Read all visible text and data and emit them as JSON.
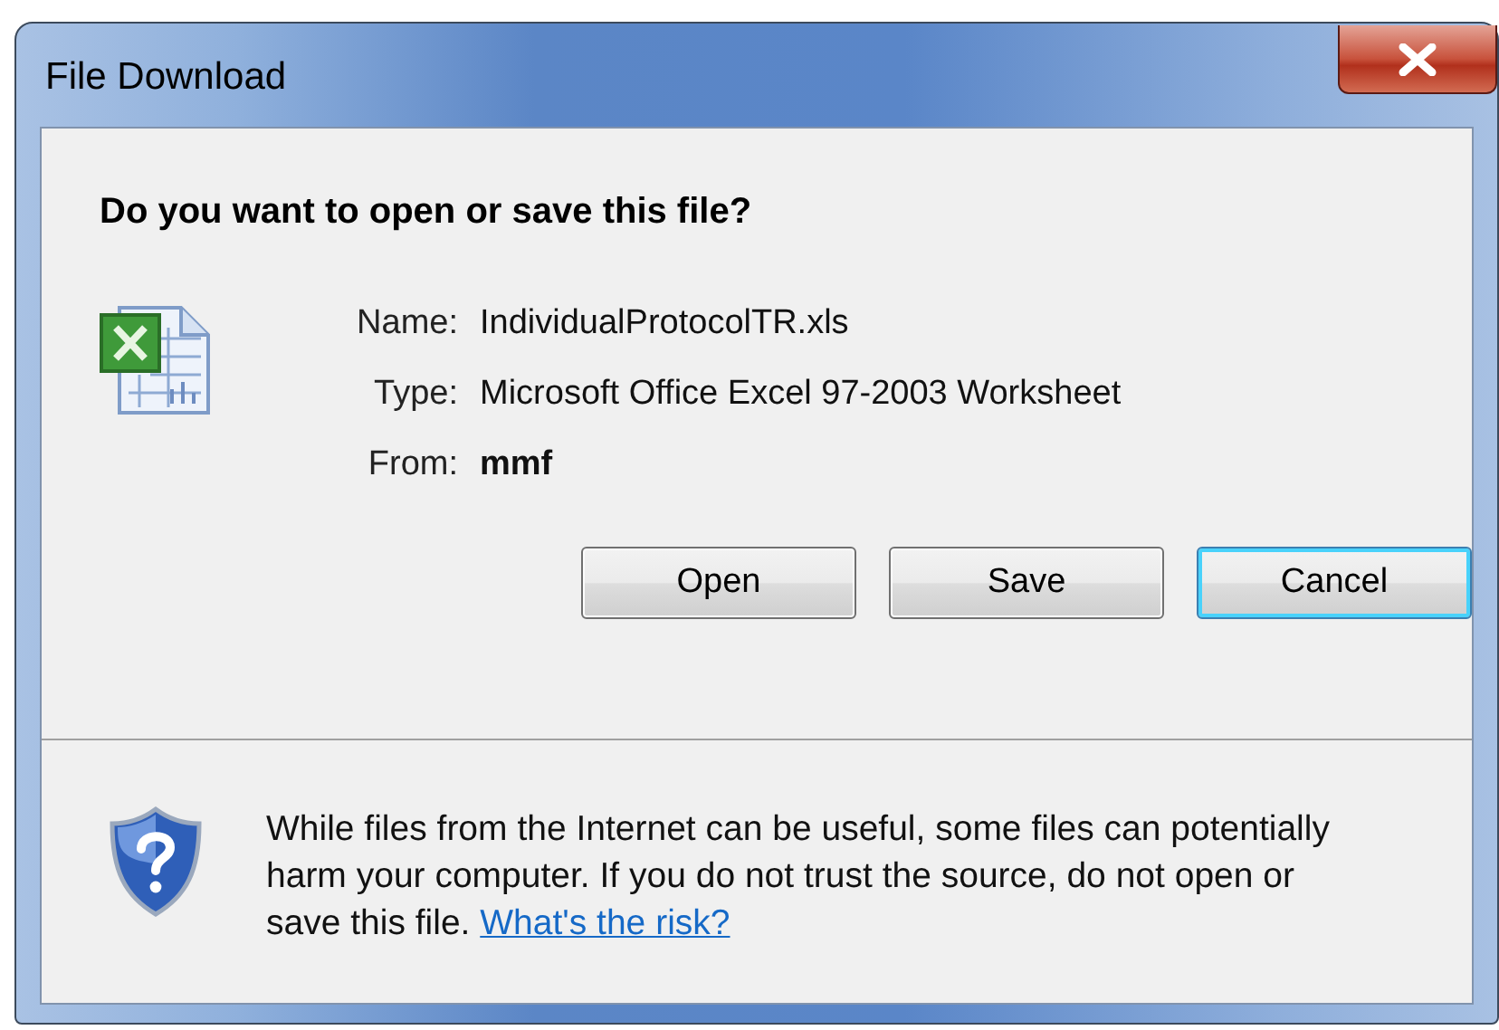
{
  "window": {
    "title": "File Download"
  },
  "heading": "Do you want to open or save this file?",
  "fields": [
    {
      "label": "Name:",
      "value": "IndividualProtocolTR.xls",
      "bold": false
    },
    {
      "label": "Type:",
      "value": "Microsoft Office Excel 97-2003 Worksheet",
      "bold": false
    },
    {
      "label": "From:",
      "value": "mmf",
      "bold": true
    }
  ],
  "buttons": [
    {
      "label": "Open",
      "default": false
    },
    {
      "label": "Save",
      "default": false
    },
    {
      "label": "Cancel",
      "default": true
    }
  ],
  "warning": {
    "text": "While files from the Internet can be useful, some files can potentially harm your computer. If you do not trust the source, do not open or save this file.",
    "link": "What's the risk?"
  }
}
